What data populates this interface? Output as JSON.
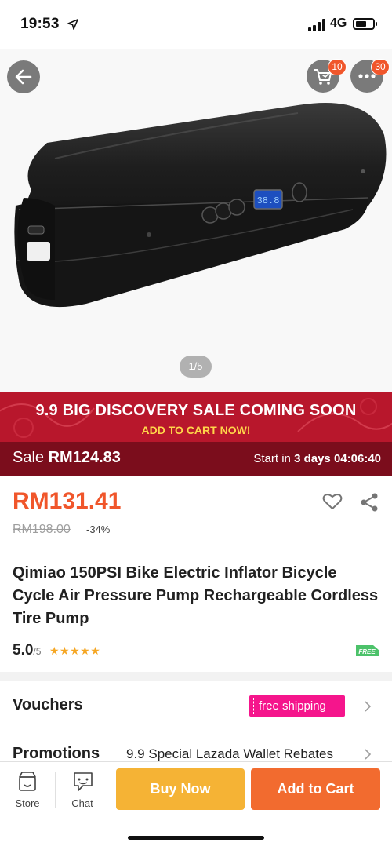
{
  "status_bar": {
    "time": "19:53",
    "network": "4G"
  },
  "gallery": {
    "cart_badge": "10",
    "more_badge": "30",
    "image_counter": "1/5",
    "device_display": "38.8"
  },
  "banner": {
    "title": "9.9 BIG DISCOVERY SALE COMING SOON",
    "subtitle": "ADD TO CART NOW!",
    "sale_prefix": "Sale",
    "sale_price": "RM124.83",
    "countdown_prefix": "Start in",
    "countdown_days": "3 days",
    "countdown_time": "04:06:40"
  },
  "product": {
    "price": "RM131.41",
    "original_price": "RM198.00",
    "discount": "-34%",
    "title": "Qimiao 150PSI Bike Electric Inflator Bicycle Cycle Air Pressure Pump Rechargeable Cordless Tire Pump",
    "rating": "5.0",
    "rating_max": "/5",
    "stars": "★★★★★",
    "rating_stars_value": 5,
    "free_shipping_tag": "FREE"
  },
  "vouchers": {
    "label": "Vouchers",
    "tag": "free shipping"
  },
  "promotions": {
    "label": "Promotions",
    "text": "9.9 Special Lazada Wallet Rebates"
  },
  "bottom_bar": {
    "store_label": "Store",
    "chat_label": "Chat",
    "buy_now_label": "Buy Now",
    "add_to_cart_label": "Add to Cart"
  },
  "colors": {
    "accent_orange": "#f0562b",
    "banner_red": "#b8172c",
    "voucher_pink": "#f5158c",
    "buy_now": "#f5b335",
    "add_to_cart": "#f26b2f"
  }
}
